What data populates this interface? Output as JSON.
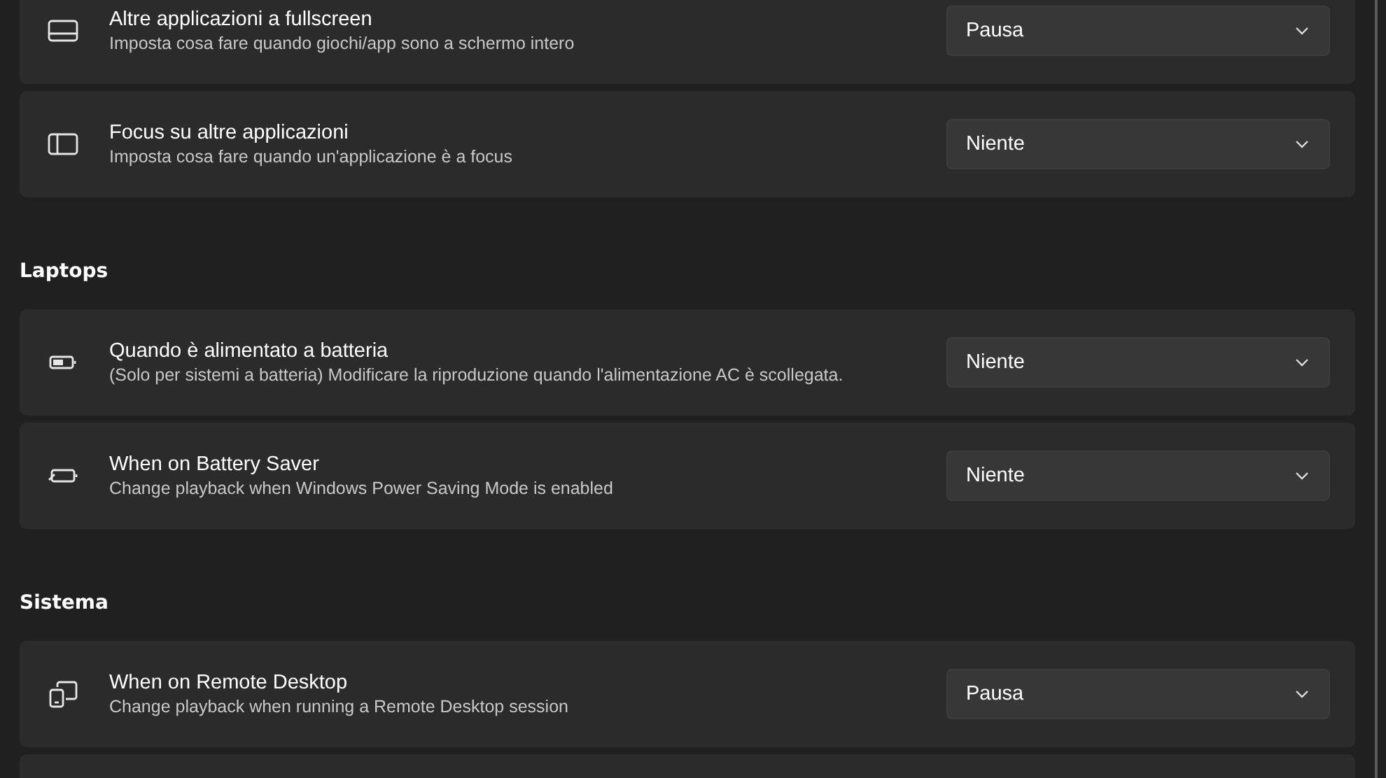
{
  "sections": [
    {
      "items": [
        {
          "kind": "fullscreen",
          "title": "Altre applicazioni a fullscreen",
          "description": "Imposta cosa fare quando giochi/app sono a schermo intero",
          "value": "Pausa"
        },
        {
          "kind": "panel",
          "title": "Focus su altre applicazioni",
          "description": "Imposta cosa fare quando un'applicazione è a focus",
          "value": "Niente"
        }
      ]
    },
    {
      "title": "Laptops",
      "items": [
        {
          "kind": "battery",
          "title": "Quando è alimentato a batteria",
          "description": "(Solo per sistemi a batteria) Modificare la riproduzione quando l'alimentazione AC è scollegata.",
          "value": "Niente"
        },
        {
          "kind": "saver",
          "title": "When on Battery Saver",
          "description": "Change playback when Windows Power Saving Mode is enabled",
          "value": "Niente"
        }
      ]
    },
    {
      "title": "Sistema",
      "items": [
        {
          "kind": "remote",
          "title": "When on Remote Desktop",
          "description": "Change playback when running a Remote Desktop session",
          "value": "Pausa"
        }
      ]
    }
  ]
}
